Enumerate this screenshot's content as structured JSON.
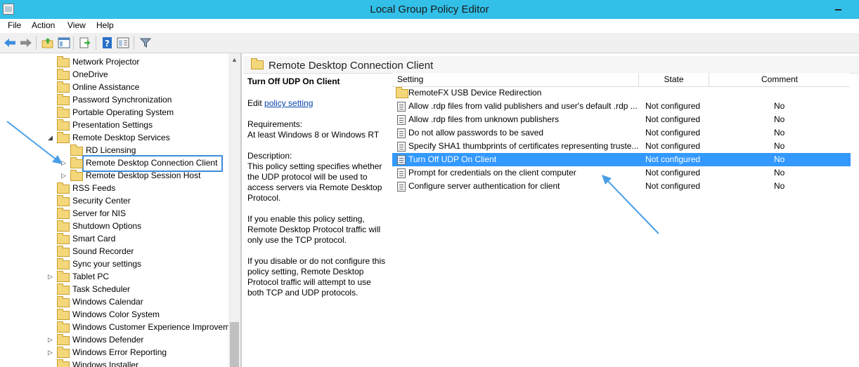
{
  "window": {
    "title": "Local Group Policy Editor"
  },
  "menu": [
    "File",
    "Action",
    "View",
    "Help"
  ],
  "toolbar": {
    "icons": [
      "back-arrow-icon",
      "forward-arrow-icon",
      "up-folder-icon",
      "show-hide-tree-icon",
      "export-list-icon",
      "help-icon",
      "properties-icon",
      "filter-icon"
    ]
  },
  "tree": {
    "items": [
      {
        "label": "Network Projector",
        "level": 1,
        "expander": ""
      },
      {
        "label": "OneDrive",
        "level": 1,
        "expander": ""
      },
      {
        "label": "Online Assistance",
        "level": 1,
        "expander": ""
      },
      {
        "label": "Password Synchronization",
        "level": 1,
        "expander": ""
      },
      {
        "label": "Portable Operating System",
        "level": 1,
        "expander": ""
      },
      {
        "label": "Presentation Settings",
        "level": 1,
        "expander": ""
      },
      {
        "label": "Remote Desktop Services",
        "level": 1,
        "expander": "◢"
      },
      {
        "label": "RD Licensing",
        "level": 2,
        "expander": ""
      },
      {
        "label": "Remote Desktop Connection Client",
        "level": 2,
        "expander": "▷",
        "selected": true
      },
      {
        "label": "Remote Desktop Session Host",
        "level": 2,
        "expander": "▷"
      },
      {
        "label": "RSS Feeds",
        "level": 1,
        "expander": ""
      },
      {
        "label": "Security Center",
        "level": 1,
        "expander": ""
      },
      {
        "label": "Server for NIS",
        "level": 1,
        "expander": ""
      },
      {
        "label": "Shutdown Options",
        "level": 1,
        "expander": ""
      },
      {
        "label": "Smart Card",
        "level": 1,
        "expander": ""
      },
      {
        "label": "Sound Recorder",
        "level": 1,
        "expander": ""
      },
      {
        "label": "Sync your settings",
        "level": 1,
        "expander": ""
      },
      {
        "label": "Tablet PC",
        "level": 1,
        "expander": "▷"
      },
      {
        "label": "Task Scheduler",
        "level": 1,
        "expander": ""
      },
      {
        "label": "Windows Calendar",
        "level": 1,
        "expander": ""
      },
      {
        "label": "Windows Color System",
        "level": 1,
        "expander": ""
      },
      {
        "label": "Windows Customer Experience Improvem",
        "level": 1,
        "expander": ""
      },
      {
        "label": "Windows Defender",
        "level": 1,
        "expander": "▷"
      },
      {
        "label": "Windows Error Reporting",
        "level": 1,
        "expander": "▷"
      },
      {
        "label": "Windows Installer",
        "level": 1,
        "expander": ""
      }
    ]
  },
  "details": {
    "header": "Remote Desktop Connection Client",
    "policy_title": "Turn Off UDP On Client",
    "edit_prefix": "Edit",
    "edit_link": "policy setting",
    "requirements_label": "Requirements:",
    "requirements_value": "At least Windows 8 or Windows RT",
    "description_label": "Description:",
    "description": "This policy setting specifies whether the UDP protocol will be used to access servers via Remote Desktop Protocol.",
    "enable_text": "If you enable this policy setting, Remote Desktop Protocol traffic will only use the TCP protocol.",
    "disable_text": "If you disable or do not configure this policy setting, Remote Desktop Protocol traffic will attempt to use both TCP and UDP protocols."
  },
  "table": {
    "columns": [
      "Setting",
      "State",
      "Comment"
    ],
    "rows": [
      {
        "setting": "RemoteFX USB Device Redirection",
        "state": "",
        "comment": "",
        "type": "folder"
      },
      {
        "setting": "Allow .rdp files from valid publishers and user's default .rdp ...",
        "state": "Not configured",
        "comment": "No",
        "type": "policy"
      },
      {
        "setting": "Allow .rdp files from unknown publishers",
        "state": "Not configured",
        "comment": "No",
        "type": "policy"
      },
      {
        "setting": "Do not allow passwords to be saved",
        "state": "Not configured",
        "comment": "No",
        "type": "policy"
      },
      {
        "setting": "Specify SHA1 thumbprints of certificates representing truste...",
        "state": "Not configured",
        "comment": "No",
        "type": "policy"
      },
      {
        "setting": "Turn Off UDP On Client",
        "state": "Not configured",
        "comment": "No",
        "type": "policy",
        "selected": true
      },
      {
        "setting": "Prompt for credentials on the client computer",
        "state": "Not configured",
        "comment": "No",
        "type": "policy"
      },
      {
        "setting": "Configure server authentication for client",
        "state": "Not configured",
        "comment": "No",
        "type": "policy"
      }
    ]
  },
  "colors": {
    "titlebar": "#32c0e8",
    "selection": "#3399ff",
    "annotation_arrow": "#4a9ee6"
  }
}
